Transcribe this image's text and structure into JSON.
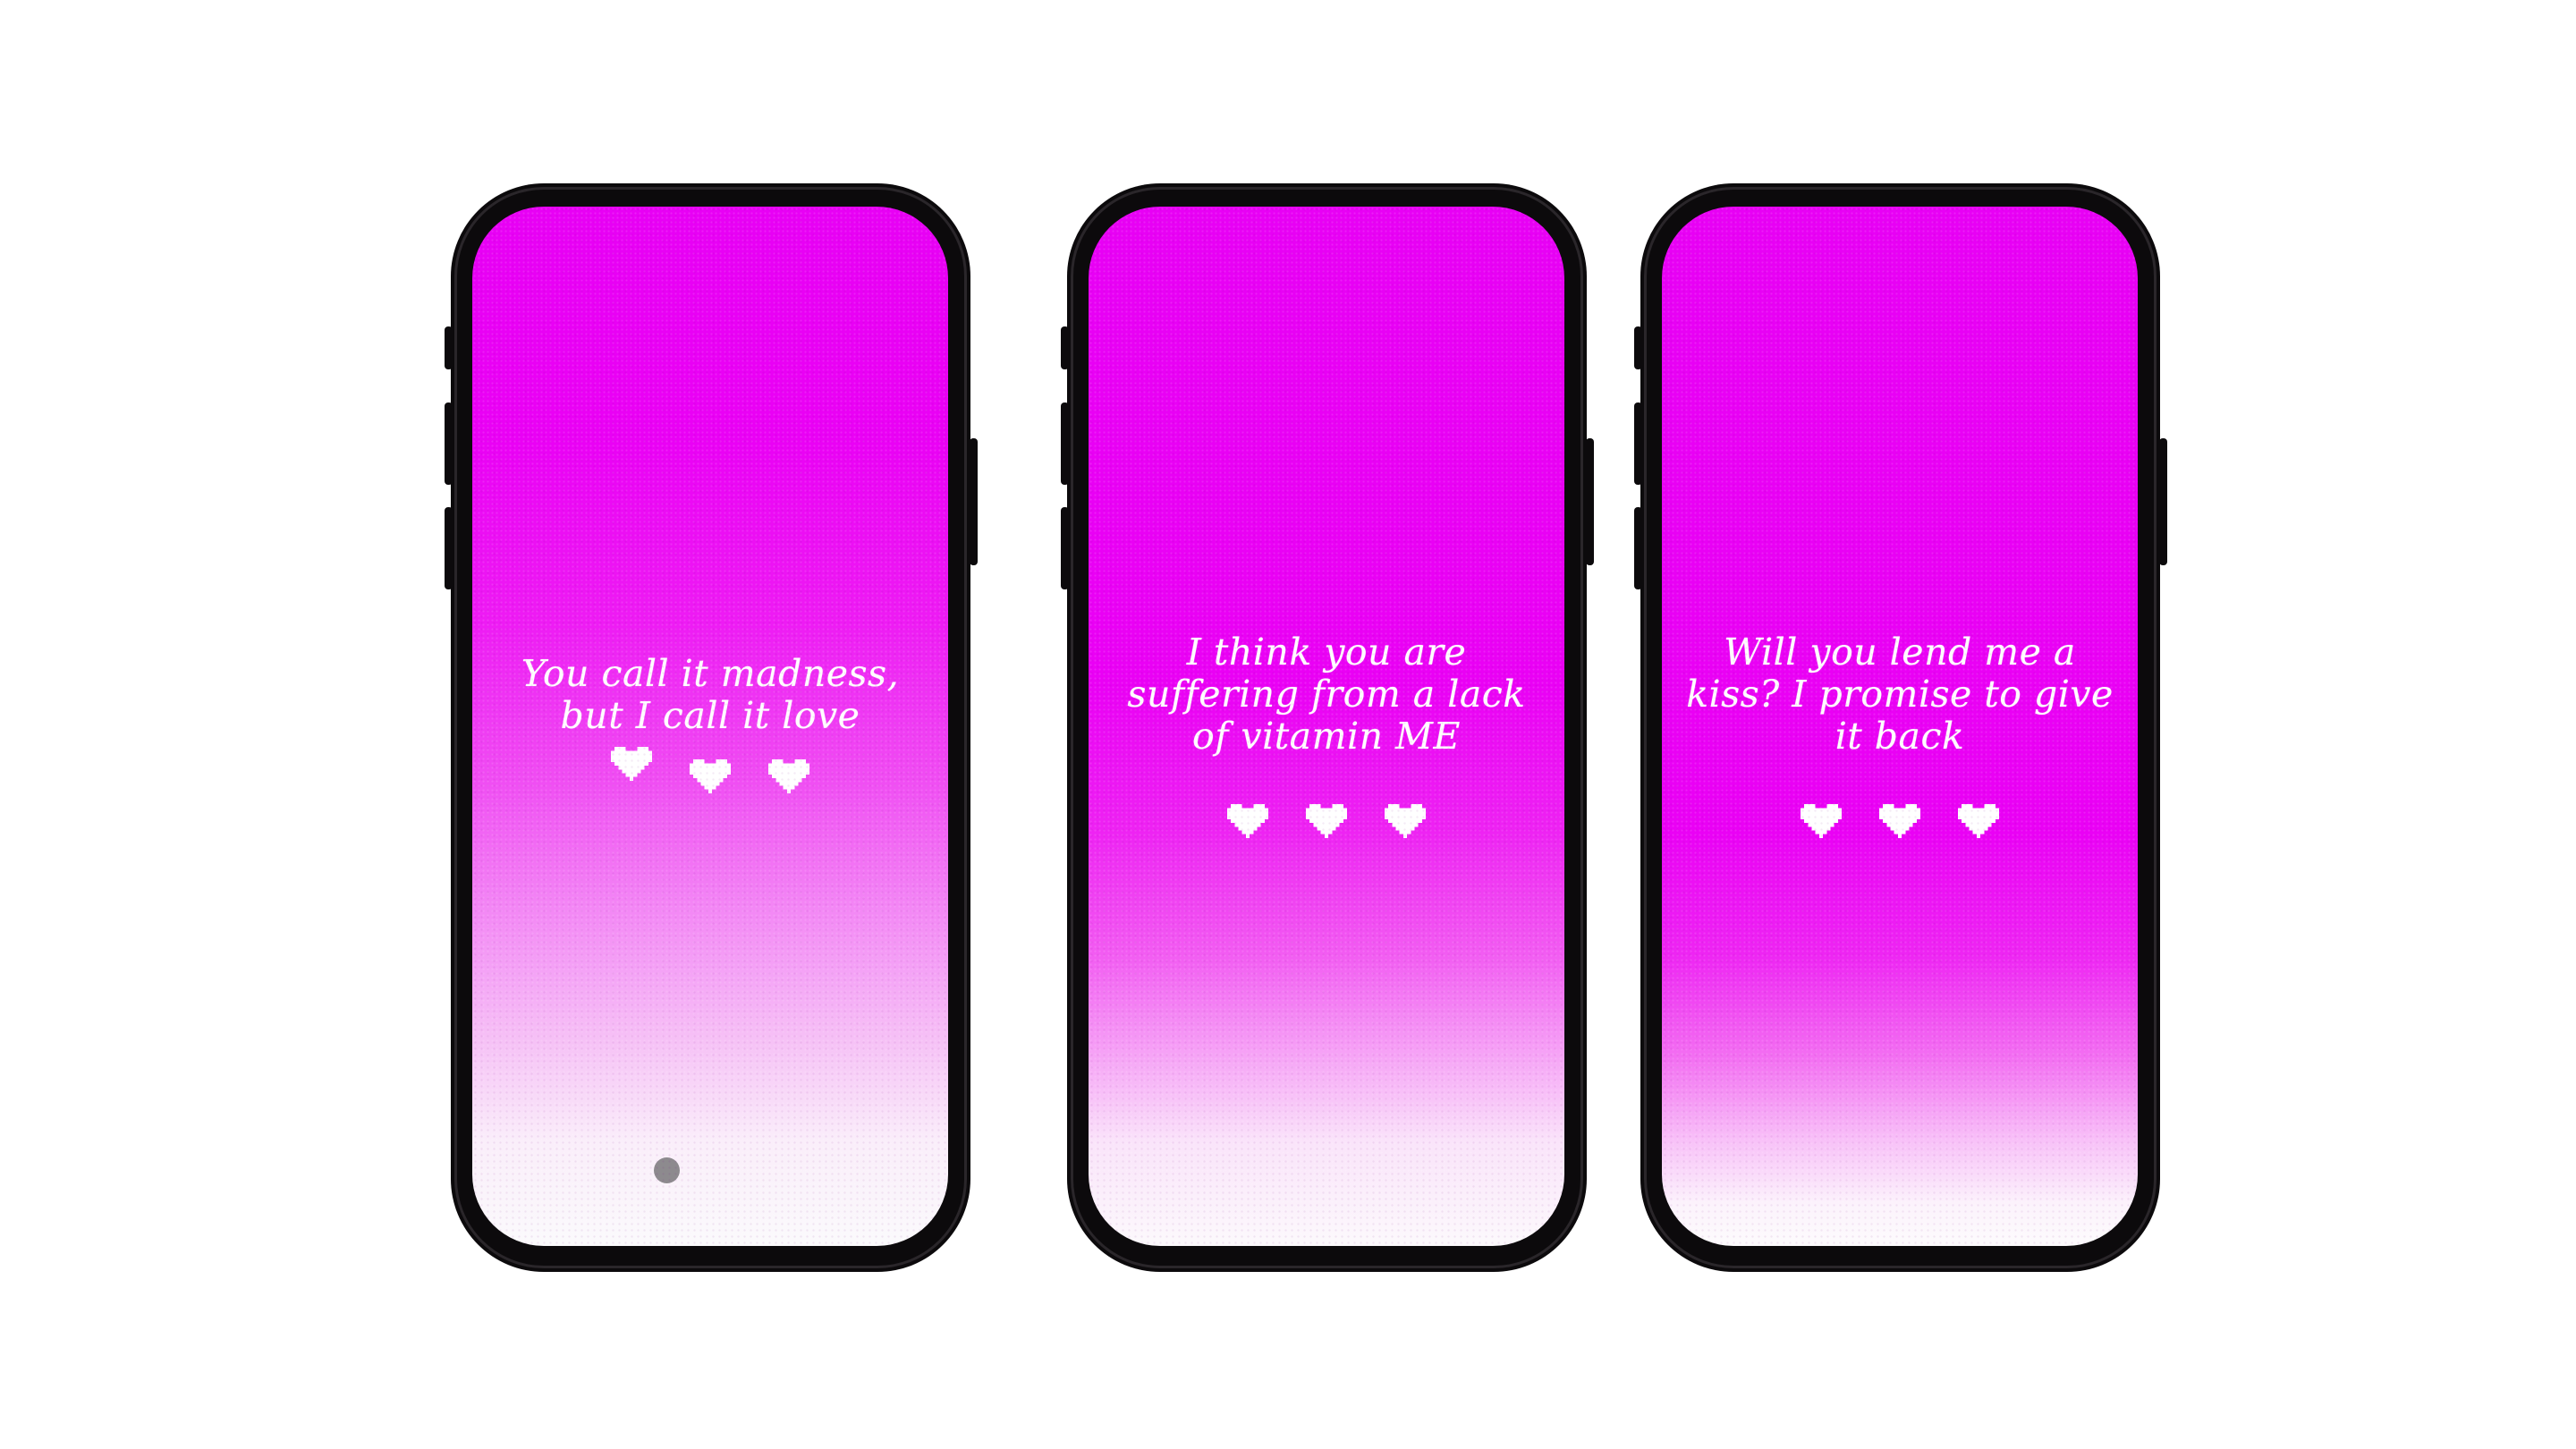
{
  "phones": [
    {
      "quote": "You call it madness,\nbut I call it love",
      "hearts": [
        "heart-icon",
        "heart-icon",
        "heart-icon"
      ],
      "has_home_indicator": true
    },
    {
      "quote": "I think you are\nsuffering from a lack\nof vitamin ME",
      "hearts": [
        "heart-icon",
        "heart-icon",
        "heart-icon"
      ],
      "has_home_indicator": false
    },
    {
      "quote": "Will you lend me a\nkiss? I promise to give\nit back",
      "hearts": [
        "heart-icon",
        "heart-icon",
        "heart-icon"
      ],
      "has_home_indicator": false
    }
  ],
  "colors": {
    "screen_top": "#e800f5",
    "screen_bottom": "#fbfafc",
    "phone_frame": "#0c0a0c",
    "text": "#ffffff",
    "home_indicator": "#8d8a8e"
  }
}
